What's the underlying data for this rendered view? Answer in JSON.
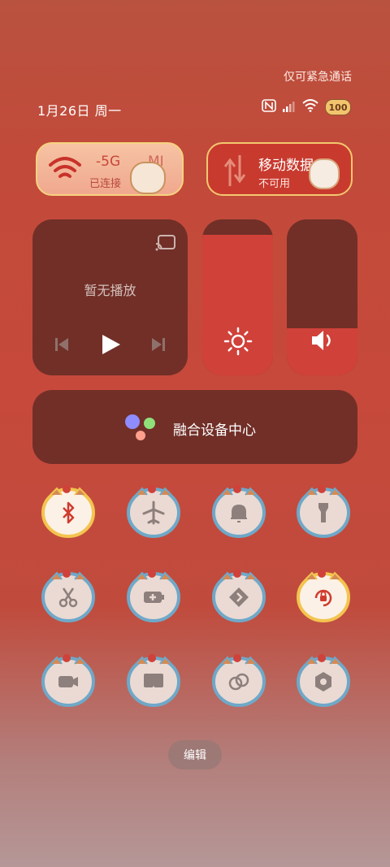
{
  "header": {
    "emergency_text": "仅可紧急通话",
    "date_text": "1月26日 周一",
    "battery_level": "100"
  },
  "status_icons": [
    "nfc-icon",
    "signal-icon",
    "wifi-status-icon",
    "battery-icon"
  ],
  "wifi_tile": {
    "name": "-5G",
    "name_suffix": "MI",
    "status": "已连接"
  },
  "mobile_tile": {
    "title": "移动数据",
    "status": "不可用"
  },
  "media": {
    "label": "暂无播放"
  },
  "sliders": {
    "brightness_level": 0.9,
    "volume_level": 0.3
  },
  "devices": {
    "label": "融合设备中心"
  },
  "toggles": [
    {
      "icon": "bluetooth-icon",
      "active": true
    },
    {
      "icon": "airplane-icon",
      "active": false
    },
    {
      "icon": "bell-icon",
      "active": false
    },
    {
      "icon": "flashlight-icon",
      "active": false
    },
    {
      "icon": "screenshot-icon",
      "active": false
    },
    {
      "icon": "battery-saver-icon",
      "active": false
    },
    {
      "icon": "location-icon",
      "active": false
    },
    {
      "icon": "rotation-lock-icon",
      "active": true
    },
    {
      "icon": "screen-record-icon",
      "active": false
    },
    {
      "icon": "cast-icon",
      "active": false
    },
    {
      "icon": "hotspot-icon",
      "active": false
    },
    {
      "icon": "settings-icon",
      "active": false
    }
  ],
  "edit": {
    "label": "编辑"
  },
  "colors": {
    "active_tile_border": "#f3c44f",
    "inactive_tile_border": "#6fa8c8",
    "slider_fill": "#d0413a"
  }
}
